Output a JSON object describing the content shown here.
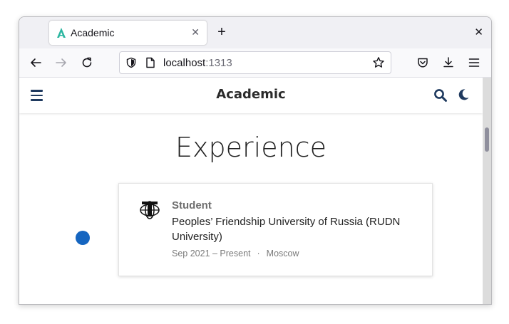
{
  "browser": {
    "tab_title": "Academic",
    "url_host": "localhost",
    "url_port": ":1313",
    "icons": {
      "tab_favicon": "academic-logo-icon",
      "tab_close": "close-icon",
      "new_tab": "plus-icon",
      "window_close": "close-icon",
      "back": "back-arrow-icon",
      "forward": "forward-arrow-icon",
      "reload": "reload-icon",
      "shield": "shield-icon",
      "page": "page-icon",
      "bookmark": "star-icon",
      "pocket": "pocket-icon",
      "downloads": "download-icon",
      "menu": "hamburger-icon"
    },
    "tab_close_glyph": "✕",
    "new_tab_glyph": "+",
    "window_close_glyph": "✕"
  },
  "site": {
    "title": "Academic",
    "icons": {
      "menu": "hamburger-icon",
      "search": "search-icon",
      "theme": "moon-icon"
    },
    "accent_color": "#1565c0",
    "nav_color": "#1f3a5f"
  },
  "experience": {
    "heading": "Experience",
    "items": [
      {
        "role": "Student",
        "organization": "Peoples’ Friendship University of Russia (RUDN University)",
        "date_range": "Sep 2021 – Present",
        "separator": "·",
        "location": "Moscow",
        "logo": "university-logo-icon"
      }
    ]
  }
}
